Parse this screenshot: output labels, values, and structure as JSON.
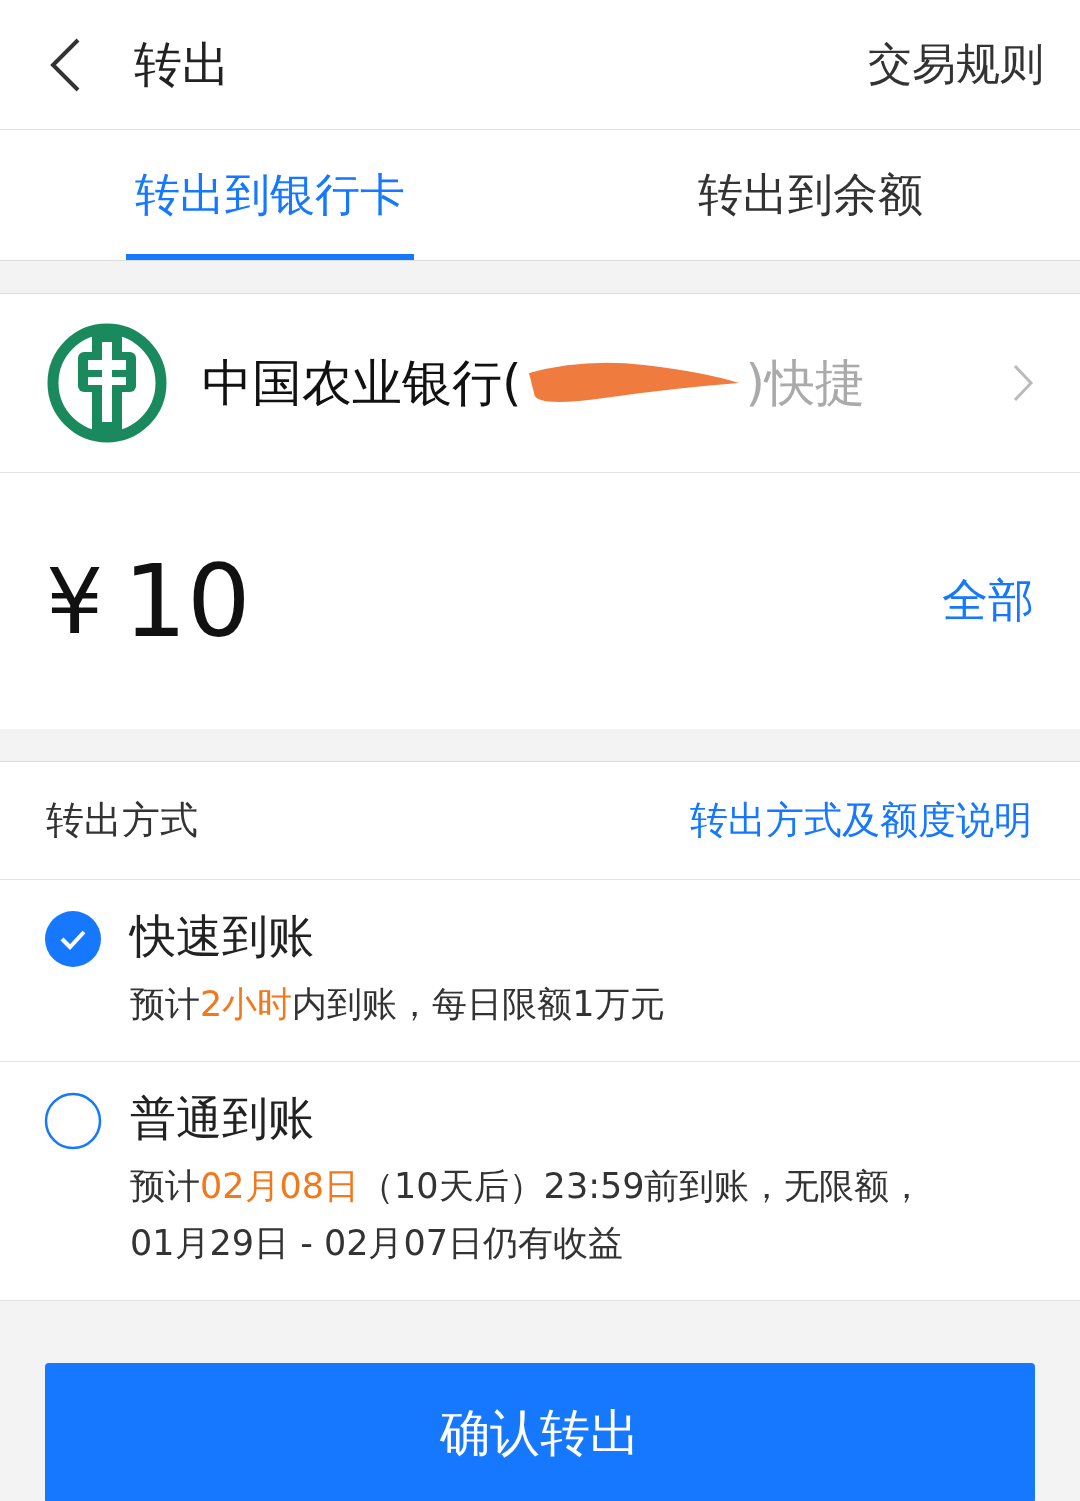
{
  "header": {
    "title": "转出",
    "rules_link": "交易规则"
  },
  "tabs": [
    {
      "label": "转出到银行卡",
      "selected": true
    },
    {
      "label": "转出到余额",
      "selected": false
    }
  ],
  "bank": {
    "name": "中国农业银行(",
    "suffix": ")快捷"
  },
  "amount": {
    "currency": "¥",
    "value": "10",
    "all_link": "全部"
  },
  "method": {
    "label": "转出方式",
    "help_link": "转出方式及额度说明"
  },
  "options": [
    {
      "title": "快速到账",
      "selected": true,
      "lines": [
        [
          {
            "text": "预计",
            "highlight": false
          },
          {
            "text": "2小时",
            "highlight": true
          },
          {
            "text": "内到账，每日限额1万元",
            "highlight": false
          }
        ]
      ]
    },
    {
      "title": "普通到账",
      "selected": false,
      "lines": [
        [
          {
            "text": "预计",
            "highlight": false
          },
          {
            "text": "02月08日",
            "highlight": true
          },
          {
            "text": "（10天后）23:59前到账，无限额，",
            "highlight": false
          }
        ],
        [
          {
            "text": "01月29日 - 02月07日仍有收益",
            "highlight": false
          }
        ]
      ]
    }
  ],
  "confirm_button": "确认转出"
}
